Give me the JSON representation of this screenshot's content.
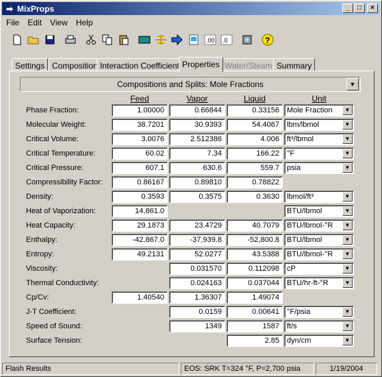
{
  "window": {
    "title": "MixProps",
    "min": "_",
    "max": "□",
    "close": "×"
  },
  "menu": [
    "File",
    "Edit",
    "View",
    "Help"
  ],
  "toolbar_icons": [
    "new-file-icon",
    "open-folder-icon",
    "save-icon",
    "print-icon",
    "cut-icon",
    "copy-icon",
    "paste-icon",
    "calculator-icon",
    "crosshair-icon",
    "arrow-right-icon",
    "page-icon",
    "number-format-icon",
    "number-format-2-icon",
    "export-icon",
    "help-icon"
  ],
  "tabs": [
    "Settings",
    "Composition",
    "Interaction Coefficients",
    "Properties",
    "Water/Steam",
    "Summary"
  ],
  "combo": {
    "value": "Compositions and Splits:  Mole Fractions",
    "arrow": "▼"
  },
  "columns": {
    "feed": "Feed",
    "vapor": "Vapor",
    "liquid": "Liquid",
    "unit": "Unit"
  },
  "rows": [
    {
      "label": "Phase Fraction:",
      "feed": "1.00000",
      "vapor": "0.66844",
      "liquid": "0.33156",
      "unit": "Mole Fraction",
      "dropdown": true
    },
    {
      "label": "Molecular Weight:",
      "feed": "38.7201",
      "vapor": "30.9393",
      "liquid": "54.4067",
      "unit": "lbm/lbmol",
      "dropdown": true
    },
    {
      "label": "Critical Volume:",
      "feed": "3.0076",
      "vapor": "2.512386",
      "liquid": "4.006",
      "unit": "ft³/lbmol",
      "dropdown": true
    },
    {
      "label": "Critical Temperature:",
      "feed": "60.02",
      "vapor": "7.34",
      "liquid": "166.22",
      "unit": "°F",
      "dropdown": true
    },
    {
      "label": "Critical Pressure:",
      "feed": "607.1",
      "vapor": "630.6",
      "liquid": "559.7",
      "unit": "psia",
      "dropdown": true
    },
    {
      "label": "Compressibility Factor:",
      "feed": "0.86167",
      "vapor": "0.89810",
      "liquid": "0.78822",
      "unit": null,
      "dropdown": false
    },
    {
      "label": "Density:",
      "feed": "0.3593",
      "vapor": "0.3575",
      "liquid": "0.3630",
      "unit": "lbmol/ft³",
      "dropdown": true
    },
    {
      "label": "Heat of Vaporization:",
      "feed": "14,861.0",
      "vapor": null,
      "liquid": null,
      "unit": "BTU/lbmol",
      "dropdown": true
    },
    {
      "label": "Heat Capacity:",
      "feed": "29.1873",
      "vapor": "23.4729",
      "liquid": "40.7079",
      "unit": "BTU/lbmol-°R",
      "dropdown": true
    },
    {
      "label": "Enthalpy:",
      "feed": "-42,867.0",
      "vapor": "-37,939.8",
      "liquid": "-52,800.8",
      "unit": "BTU/lbmol",
      "dropdown": true
    },
    {
      "label": "Entropy:",
      "feed": "49.2131",
      "vapor": "52.0277",
      "liquid": "43.5388",
      "unit": "BTU/lbmol-°R",
      "dropdown": true
    },
    {
      "label": "Viscosity:",
      "feed": null,
      "vapor": "0.031570",
      "liquid": "0.112098",
      "unit": "cP",
      "dropdown": true
    },
    {
      "label": "Thermal Conductivity:",
      "feed": null,
      "vapor": "0.024163",
      "liquid": "0.037044",
      "unit": "BTU/hr-ft-°R",
      "dropdown": true
    },
    {
      "label": "Cp/Cv:",
      "feed": "1.40540",
      "vapor": "1.36307",
      "liquid": "1.49074",
      "unit": null,
      "dropdown": false
    },
    {
      "label": "J-T Coefficient:",
      "feed": null,
      "vapor": "0.0159",
      "liquid": "0.00641",
      "unit": "°F/psia",
      "dropdown": true
    },
    {
      "label": "Speed of Sound:",
      "feed": null,
      "vapor": "1349",
      "liquid": "1587",
      "unit": "ft/s",
      "dropdown": true
    },
    {
      "label": "Surface Tension:",
      "feed": null,
      "vapor": null,
      "liquid": "2.85",
      "unit": "dyn/cm",
      "dropdown": true
    }
  ],
  "status": {
    "left": "Flash Results",
    "middle": "EOS: SRK T=324 °F, P=2,700 psia",
    "right": "1/19/2004"
  }
}
